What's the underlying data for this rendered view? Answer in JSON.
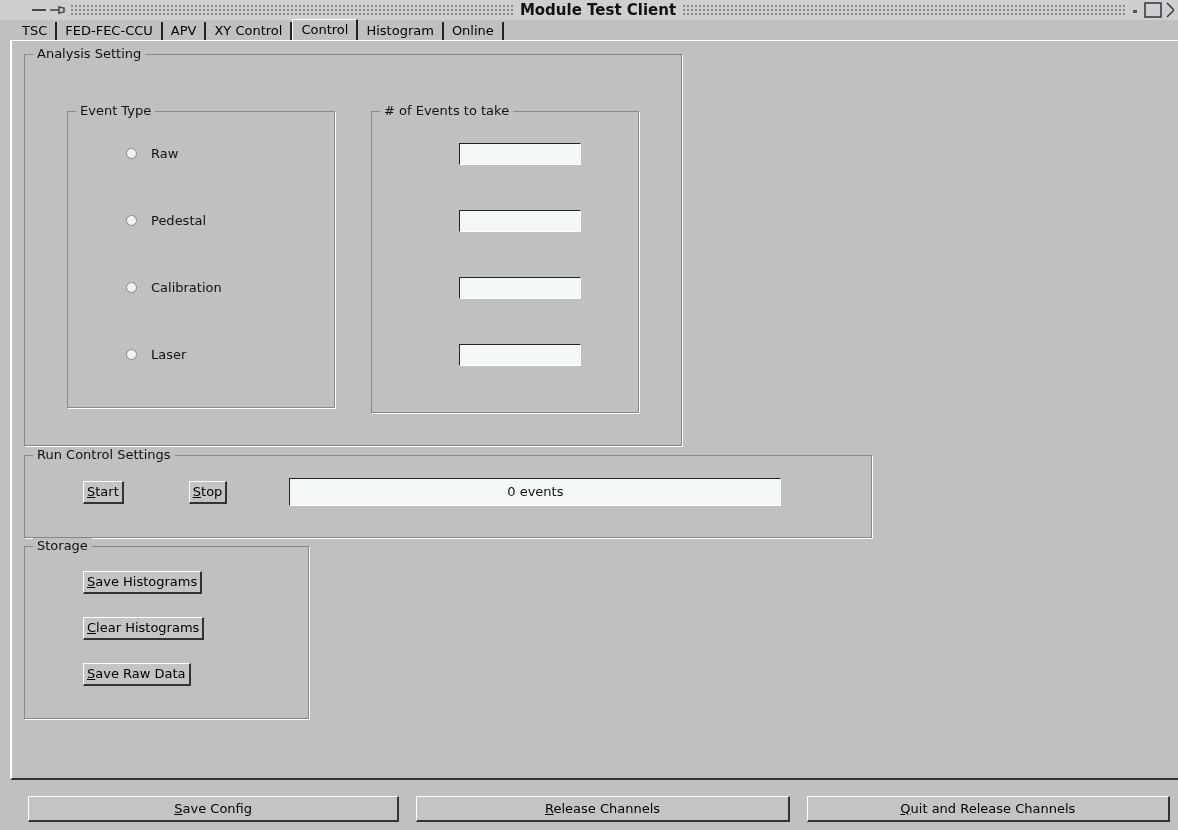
{
  "window": {
    "title": "Module Test Client"
  },
  "tabs": [
    {
      "label": "TSC",
      "selected": false
    },
    {
      "label": "FED-FEC-CCU",
      "selected": false
    },
    {
      "label": "APV",
      "selected": false
    },
    {
      "label": "XY Control",
      "selected": false
    },
    {
      "label": "Control",
      "selected": true
    },
    {
      "label": "Histogram",
      "selected": false
    },
    {
      "label": "Online",
      "selected": false
    }
  ],
  "analysis_setting": {
    "title": "Analysis Setting",
    "event_type": {
      "title": "Event Type",
      "options": [
        {
          "label": "Raw",
          "checked": false
        },
        {
          "label": "Pedestal",
          "checked": false
        },
        {
          "label": "Calibration",
          "checked": false
        },
        {
          "label": "Laser",
          "checked": false
        }
      ]
    },
    "events_to_take": {
      "title": "# of Events to take",
      "fields": [
        {
          "enabled": true
        },
        {
          "enabled": true
        },
        {
          "enabled": true
        },
        {
          "enabled": true
        }
      ]
    }
  },
  "run_control_settings": {
    "title": "Run Control Settings",
    "buttons": [
      {
        "label": "Start",
        "underline_first": true
      },
      {
        "label": "Stop",
        "underline_first": true
      }
    ],
    "status": "0 events"
  },
  "storage": {
    "title": "Storage",
    "buttons": [
      {
        "label": "Save Histograms",
        "underline_first": true
      },
      {
        "label": "Clear Histograms",
        "underline_first": true
      },
      {
        "label": "Save Raw Data",
        "underline_first": true
      }
    ]
  },
  "footer_buttons": [
    {
      "label": "Save Config",
      "underline_first": true
    },
    {
      "label": "Release Channels",
      "underline_first": true
    },
    {
      "label": "Quit and Release Channels",
      "underline_first": true
    }
  ]
}
